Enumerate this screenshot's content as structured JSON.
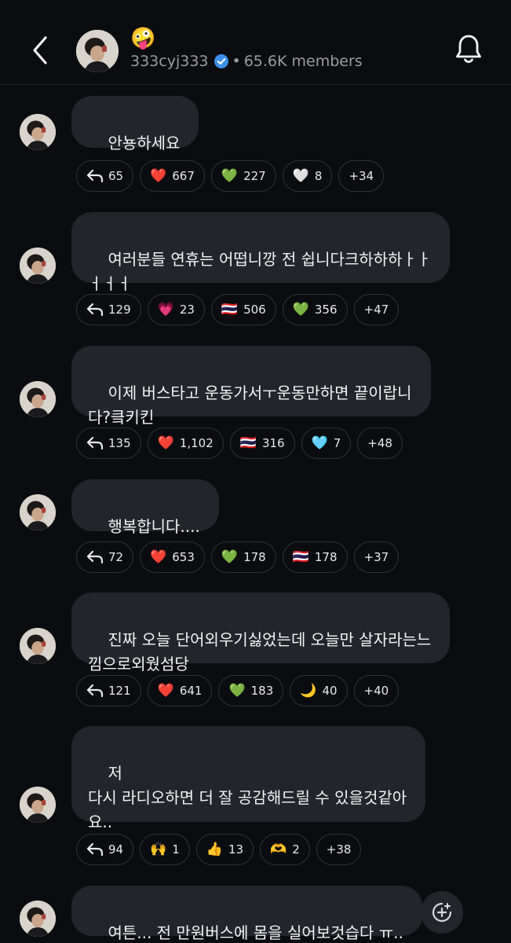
{
  "header": {
    "emoji": "🤪",
    "channel_name": "333cyj333",
    "separator": "•",
    "members": "65.6K members"
  },
  "messages": [
    {
      "text": "안뇽하세요",
      "reactions": [
        {
          "icon": "reply-icon",
          "count": "65"
        },
        {
          "emoji": "❤️",
          "count": "667"
        },
        {
          "emoji": "💚",
          "count": "227"
        },
        {
          "emoji": "🤍",
          "count": "8"
        },
        {
          "count": "+34"
        }
      ]
    },
    {
      "text": "여러분들 연휴는 어떱니깡 전 쉽니다크하하하ㅏㅏ\nㅓㅓㅓ",
      "reactions": [
        {
          "icon": "reply-icon",
          "count": "129"
        },
        {
          "emoji": "💗",
          "count": "23"
        },
        {
          "emoji": "🇹🇭",
          "count": "506"
        },
        {
          "emoji": "💚",
          "count": "356"
        },
        {
          "count": "+47"
        }
      ]
    },
    {
      "text": "이제 버스타고 운동가서ㅜ운동만하면 끝이랍니\n다?킄키킨",
      "reactions": [
        {
          "icon": "reply-icon",
          "count": "135"
        },
        {
          "emoji": "❤️",
          "count": "1,102"
        },
        {
          "emoji": "🇹🇭",
          "count": "316"
        },
        {
          "emoji": "🩵",
          "count": "7"
        },
        {
          "count": "+48"
        }
      ]
    },
    {
      "text": "행복합니다....",
      "reactions": [
        {
          "icon": "reply-icon",
          "count": "72"
        },
        {
          "emoji": "❤️",
          "count": "653"
        },
        {
          "emoji": "💚",
          "count": "178"
        },
        {
          "emoji": "🇹🇭",
          "count": "178"
        },
        {
          "count": "+37"
        }
      ]
    },
    {
      "text": "진짜 오늘 단어외우기싫었는데 오늘만 살자라는느\n낌으로외웠섬당",
      "reactions": [
        {
          "icon": "reply-icon",
          "count": "121"
        },
        {
          "emoji": "❤️",
          "count": "641"
        },
        {
          "emoji": "💚",
          "count": "183"
        },
        {
          "emoji": "🌙",
          "count": "40"
        },
        {
          "count": "+40"
        }
      ]
    },
    {
      "text": "저\n다시 라디오하면 더 잘 공감해드릴 수 있을것같아\n요..",
      "reactions": [
        {
          "icon": "reply-icon",
          "count": "94"
        },
        {
          "emoji": "🙌",
          "count": "1"
        },
        {
          "emoji": "👍",
          "count": "13"
        },
        {
          "emoji": "🫶",
          "count": "2"
        },
        {
          "count": "+38"
        }
      ]
    },
    {
      "text": "여튼... 전 만원버스에 몸을 실어보것습다 ㅠ..",
      "reactions": []
    }
  ]
}
